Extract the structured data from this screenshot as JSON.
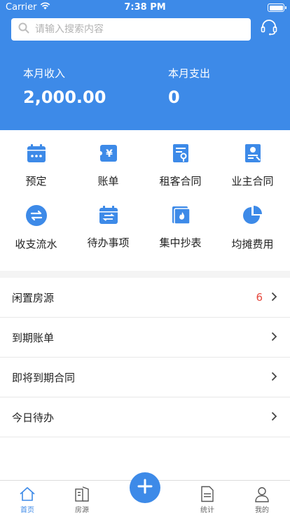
{
  "status_bar": {
    "carrier": "Carrier",
    "time": "7:38 PM"
  },
  "search": {
    "placeholder": "请输入搜索内容"
  },
  "summary": {
    "income": {
      "label": "本月收入",
      "value": "2,000.00"
    },
    "expense": {
      "label": "本月支出",
      "value": "0"
    }
  },
  "grid": [
    {
      "label": "预定",
      "icon": "calendar-icon"
    },
    {
      "label": "账单",
      "icon": "bill-icon"
    },
    {
      "label": "租客合同",
      "icon": "tenant-contract-icon"
    },
    {
      "label": "业主合同",
      "icon": "owner-contract-icon"
    },
    {
      "label": "收支流水",
      "icon": "transfer-icon"
    },
    {
      "label": "待办事项",
      "icon": "todo-calendar-icon"
    },
    {
      "label": "集中抄表",
      "icon": "meter-icon"
    },
    {
      "label": "均摊费用",
      "icon": "pie-chart-icon"
    }
  ],
  "list": [
    {
      "title": "闲置房源",
      "badge": "6"
    },
    {
      "title": "到期账单",
      "badge": ""
    },
    {
      "title": "即将到期合同",
      "badge": ""
    },
    {
      "title": "今日待办",
      "badge": ""
    }
  ],
  "tabbar": {
    "home": "首页",
    "rooms": "房源",
    "stats": "统计",
    "mine": "我的"
  },
  "colors": {
    "primary": "#3d8ae8",
    "badge": "#e5483d"
  }
}
